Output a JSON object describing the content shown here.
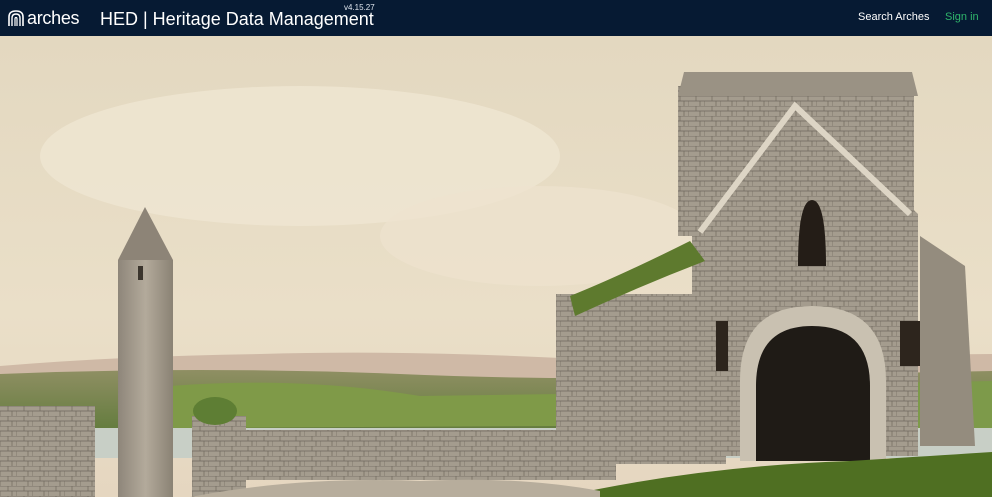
{
  "header": {
    "logo_text": "arches",
    "title": "HED | Heritage Data Management",
    "version": "v4.15.27",
    "search_label": "Search Arches",
    "signin_label": "Sign in"
  },
  "colors": {
    "header_bg": "#061a33",
    "signin_accent": "#2fb56b"
  }
}
